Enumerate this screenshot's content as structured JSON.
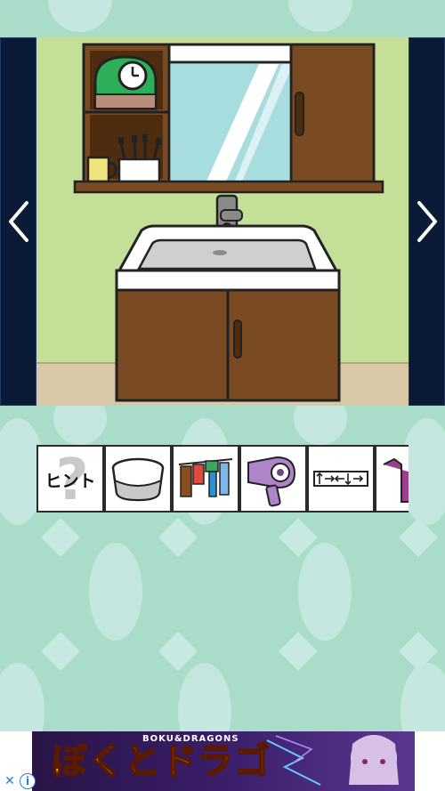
{
  "scene": {
    "name": "washroom-sink",
    "background_color": "#c4df98",
    "floor_color": "#d8c8a8",
    "cabinet_color": "#7a4a22",
    "sink_color": "#ffffff",
    "clock_color": "#2fae5a"
  },
  "navigation": {
    "left_icon": "chevron-left-icon",
    "right_icon": "chevron-right-icon"
  },
  "inventory": {
    "hint_label": "ヒント",
    "hint_mark": "?",
    "items": [
      {
        "icon": "hint-icon"
      },
      {
        "icon": "bowl-icon"
      },
      {
        "icon": "clothes-icon"
      },
      {
        "icon": "hair-dryer-icon"
      },
      {
        "icon": "arrow-code-icon"
      },
      {
        "icon": "shirt-icon"
      }
    ]
  },
  "ad": {
    "title": "ぼくとドラゴン",
    "subtitle": "BOKU&DRAGONS",
    "close_label": "✕",
    "info_label": "i"
  },
  "colors": {
    "page_bg": "#a9dcc9",
    "nav_bg": "#0b1a36",
    "pattern": "#c6e9e2"
  }
}
